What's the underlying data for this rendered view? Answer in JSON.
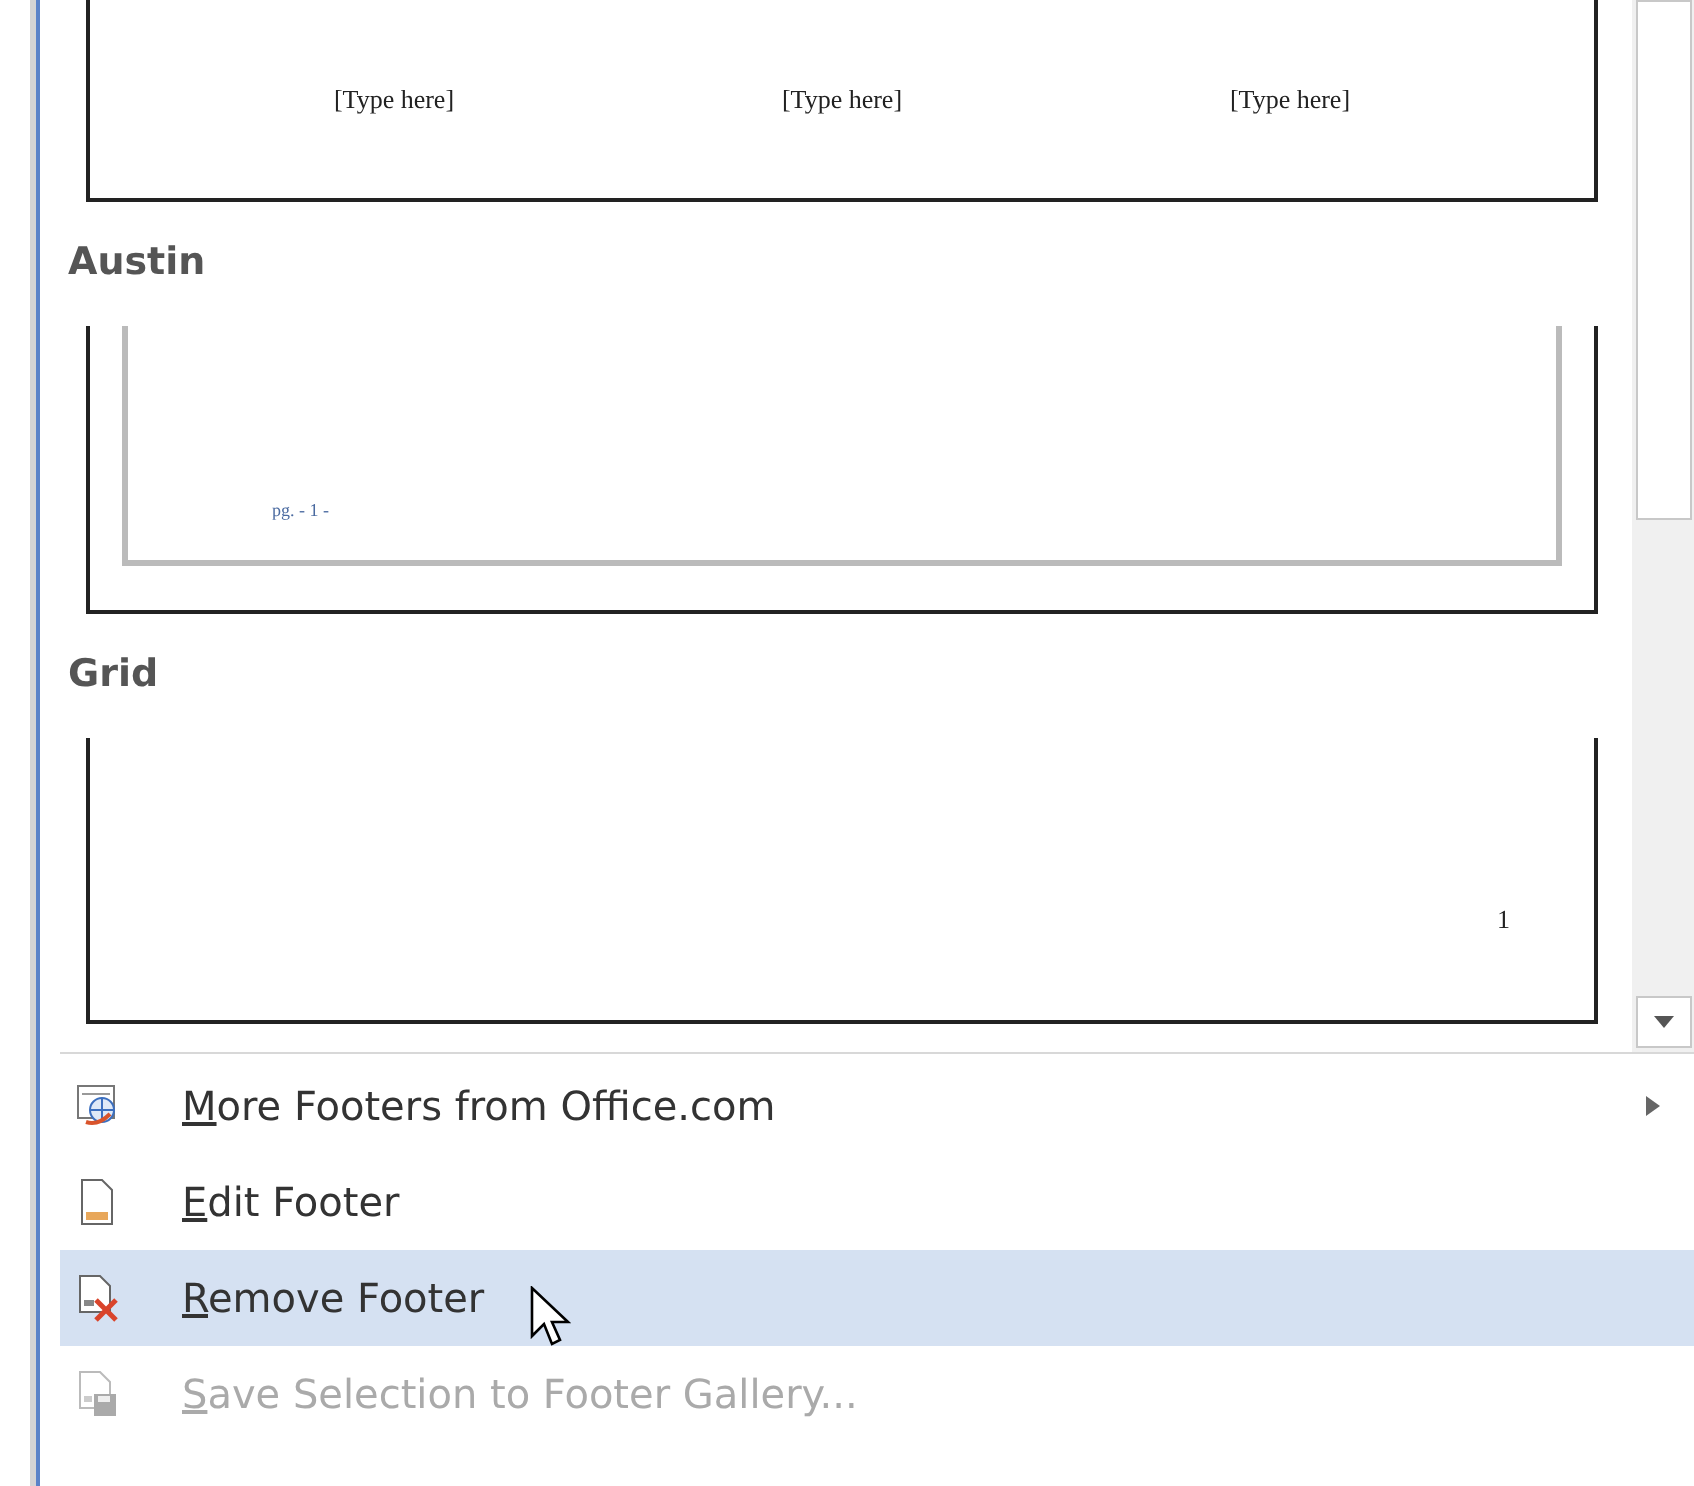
{
  "gallery": {
    "items": [
      {
        "kind": "three-column",
        "texts": [
          "[Type here]",
          "[Type here]",
          "[Type here]"
        ]
      },
      {
        "kind": "austin",
        "title": "Austin",
        "texts": [
          "pg. - 1 -"
        ]
      },
      {
        "kind": "grid",
        "title": "Grid",
        "texts": [
          "1"
        ]
      }
    ]
  },
  "menu": [
    {
      "label": "More Footers from Office.com",
      "kind": "globe-page",
      "selected": false,
      "disabled": false,
      "submenu": true
    },
    {
      "label": "Edit Footer",
      "kind": "page",
      "selected": false,
      "disabled": false,
      "submenu": false
    },
    {
      "label": "Remove Footer",
      "kind": "page-x",
      "selected": true,
      "disabled": false,
      "submenu": false
    },
    {
      "label": "Save Selection to Footer Gallery...",
      "kind": "page-disk",
      "selected": false,
      "disabled": true,
      "submenu": false
    }
  ]
}
